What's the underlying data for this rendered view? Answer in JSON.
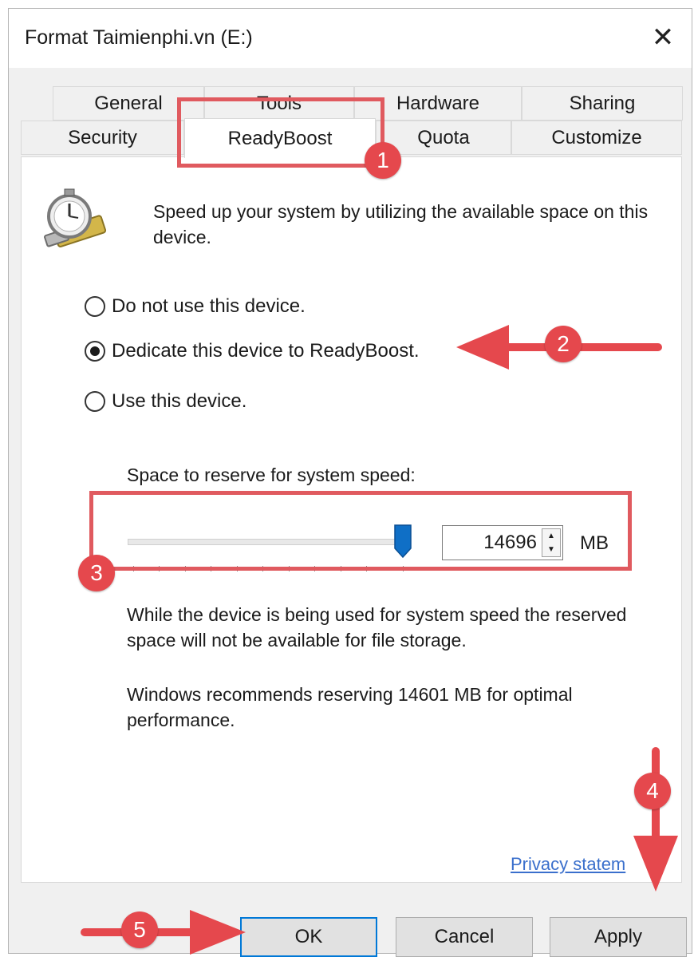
{
  "window": {
    "title": "Format Taimienphi.vn (E:)",
    "close_glyph": "✕"
  },
  "tabs": {
    "row_back": [
      "General",
      "Tools",
      "Hardware",
      "Sharing"
    ],
    "row_front": [
      "Security",
      "ReadyBoost",
      "Quota",
      "Customize"
    ],
    "active": "ReadyBoost"
  },
  "readyboost": {
    "icon": "readyboost-stopwatch-drive-icon",
    "description": "Speed up your system by utilizing the available space on this device.",
    "options": [
      {
        "label": "Do not use this device.",
        "checked": false
      },
      {
        "label": "Dedicate this device to ReadyBoost.",
        "checked": true
      },
      {
        "label": "Use this device.",
        "checked": false
      }
    ],
    "reserve_label": "Space to reserve for system speed:",
    "reserve_value": "14696",
    "reserve_unit": "MB",
    "slider_fraction": 1.0,
    "note_1": "While the device is being used for system speed the reserved space will not be available for file storage.",
    "note_2": "Windows recommends reserving 14601 MB for optimal performance.",
    "privacy_link": "Privacy statem"
  },
  "buttons": {
    "ok": "OK",
    "cancel": "Cancel",
    "apply": "Apply"
  },
  "annotations": {
    "step_1": "1",
    "step_2": "2",
    "step_3": "3",
    "step_4": "4",
    "step_5": "5",
    "color": "#e5484d"
  }
}
